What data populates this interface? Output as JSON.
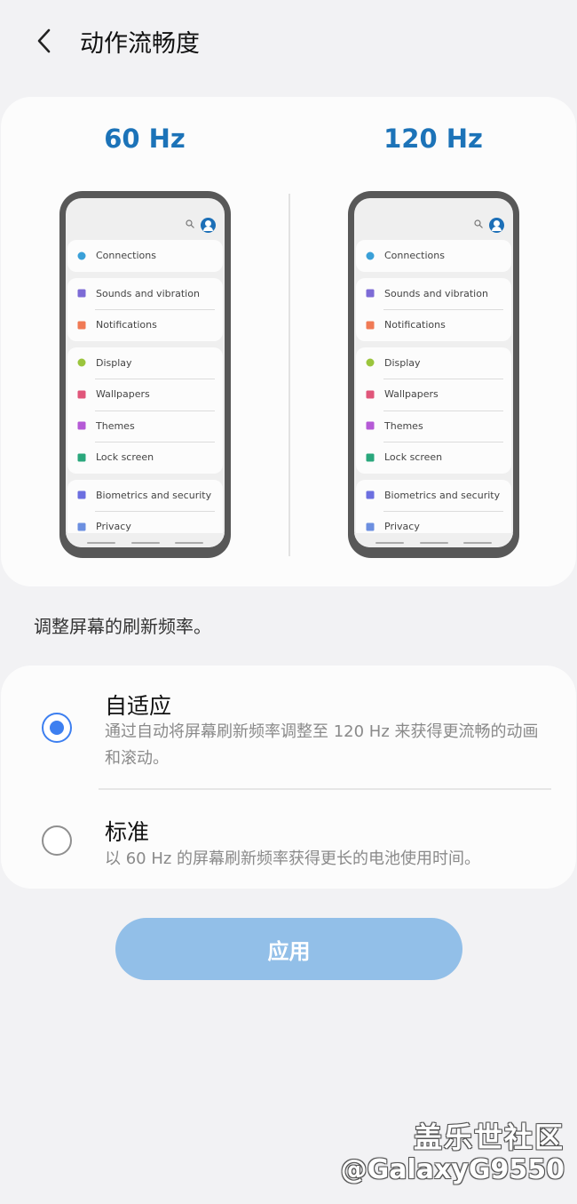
{
  "header": {
    "title": "动作流畅度"
  },
  "preview": {
    "left_label": "60 Hz",
    "right_label": "120 Hz",
    "settings_groups": [
      {
        "items": [
          {
            "label": "Connections",
            "icon": "wifi-icon",
            "color": "#3aa0d8"
          }
        ]
      },
      {
        "items": [
          {
            "label": "Sounds and vibration",
            "icon": "volume-icon",
            "color": "#7d6bd6"
          },
          {
            "label": "Notifications",
            "icon": "notification-icon",
            "color": "#f07a55"
          }
        ]
      },
      {
        "items": [
          {
            "label": "Display",
            "icon": "sun-icon",
            "color": "#9bc53d"
          },
          {
            "label": "Wallpapers",
            "icon": "wallpaper-icon",
            "color": "#e0567a"
          },
          {
            "label": "Themes",
            "icon": "brush-icon",
            "color": "#b55ad6"
          },
          {
            "label": "Lock screen",
            "icon": "lock-icon",
            "color": "#2aa77c"
          }
        ]
      },
      {
        "items": [
          {
            "label": "Biometrics and security",
            "icon": "shield-icon",
            "color": "#6c6fe0"
          },
          {
            "label": "Privacy",
            "icon": "privacy-icon",
            "color": "#6c8fe0"
          }
        ]
      }
    ]
  },
  "description": "调整屏幕的刷新频率。",
  "options": [
    {
      "title": "自适应",
      "subtitle": "通过自动将屏幕刷新频率调整至 120 Hz 来获得更流畅的动画和滚动。",
      "selected": true
    },
    {
      "title": "标准",
      "subtitle": "以 60 Hz 的屏幕刷新频率获得更长的电池使用时间。",
      "selected": false
    }
  ],
  "apply_label": "应用",
  "watermark": {
    "line1": "盖乐世社区",
    "line2": "@GalaxyG9550"
  },
  "colors": {
    "accent": "#1c73b8",
    "radio": "#3d7ff0",
    "button": "#92bfe8"
  }
}
